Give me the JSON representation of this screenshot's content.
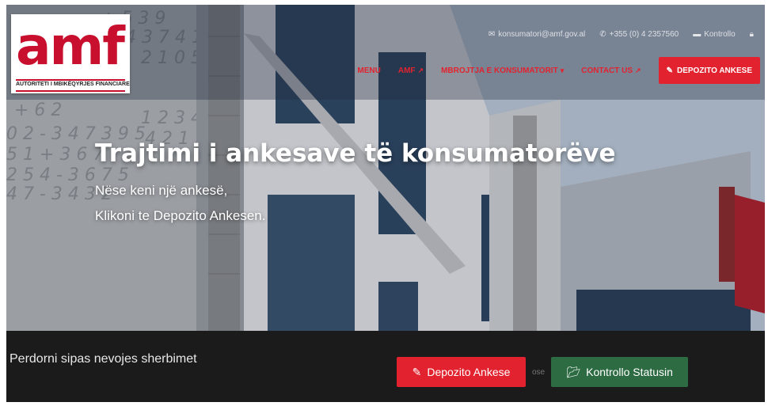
{
  "logo": {
    "mark": "amf",
    "subtitle": "AUTORITETI I MBIKËQYRJES FINANCIARE"
  },
  "topbar": {
    "email": "konsumatori@amf.gov.al",
    "phone": "+355 (0) 4 2357560",
    "control": "Kontrollo"
  },
  "nav": {
    "items": [
      {
        "label": "MENU"
      },
      {
        "label": "AMF"
      },
      {
        "label": "MBROJTJA E KONSUMATORIT"
      },
      {
        "label": "CONTACT US"
      }
    ],
    "deposit_button": "DEPOZITO ANKESE"
  },
  "hero": {
    "title": "Trajtimi i ankesave të konsumatorëve",
    "line1": "Nëse keni një ankesë,",
    "line2": "Klikoni te Depozito Ankesen."
  },
  "bottom": {
    "tagline": "Perdorni sipas nevojes sherbimet",
    "deposit_button": "Depozito Ankese",
    "or": "ose",
    "status_button": "Kontrollo Statusin"
  },
  "icons": {
    "email": "envelope-icon",
    "phone": "phone-icon",
    "control": "folder-icon",
    "lock": "lock-icon",
    "external": "external-link-icon",
    "edit": "edit-icon",
    "folder_open": "folder-open-icon"
  },
  "colors": {
    "brand_red": "#e2232f",
    "logo_red": "#c8102e",
    "status_green": "#2d6b43",
    "dark_band": "#1b1b1b"
  }
}
